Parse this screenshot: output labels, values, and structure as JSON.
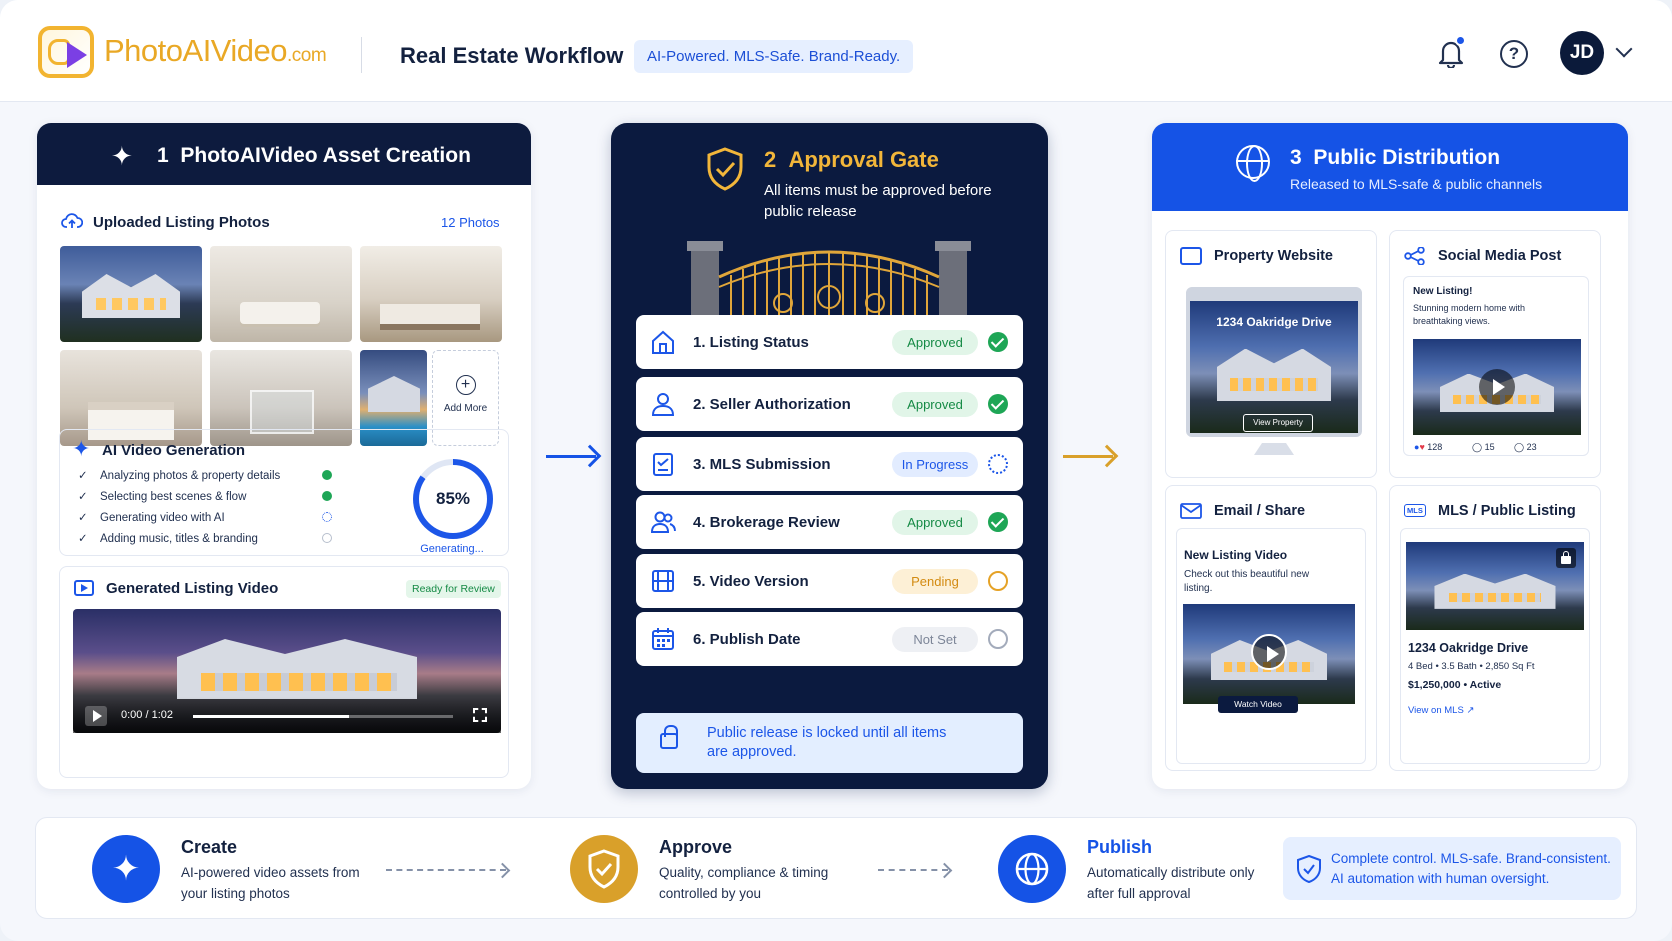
{
  "header": {
    "brand_main": "PhotoAIVideo",
    "brand_com": ".com",
    "title": "Real Estate Workflow",
    "tagline": "AI-Powered. MLS-Safe. Brand-Ready.",
    "avatar_initials": "JD",
    "help_glyph": "?"
  },
  "panel1": {
    "step": "1",
    "title": "PhotoAIVideo Asset Creation",
    "uploads_title": "Uploaded Listing Photos",
    "photo_count": "12 Photos",
    "photos": [
      "exterior-dusk",
      "living-room",
      "kitchen",
      "bedroom",
      "bathroom",
      "pool-exterior"
    ],
    "add_more": "Add More",
    "ai_title": "AI Video Generation",
    "ai_steps": [
      {
        "label": "Analyzing photos & property details",
        "status": "done"
      },
      {
        "label": "Selecting best scenes & flow",
        "status": "done"
      },
      {
        "label": "Generating video with AI",
        "status": "in-progress"
      },
      {
        "label": "Adding music, titles & branding",
        "status": "waiting"
      }
    ],
    "progress_percent": "85%",
    "progress_value": 0.85,
    "progress_label": "Generating...",
    "video_title": "Generated Listing Video",
    "video_badge": "Ready for Review",
    "video_time": "0:00 / 1:02",
    "video_played_fraction": 0.6
  },
  "panel2": {
    "step": "2",
    "title": "Approval Gate",
    "subtitle": "All items must be approved before public release",
    "items": [
      {
        "label": "1.  Listing Status",
        "status": "Approved",
        "icon": "house-icon"
      },
      {
        "label": "2.  Seller Authorization",
        "status": "Approved",
        "icon": "person-icon"
      },
      {
        "label": "3.  MLS Submission",
        "status": "In Progress",
        "icon": "clipboard-icon"
      },
      {
        "label": "4.  Brokerage Review",
        "status": "Approved",
        "icon": "people-icon"
      },
      {
        "label": "5.  Video Version",
        "status": "Pending",
        "icon": "film-icon"
      },
      {
        "label": "6.  Publish Date",
        "status": "Not Set",
        "icon": "calendar-icon"
      }
    ],
    "lock_message": "Public release is locked until all items are approved."
  },
  "panel3": {
    "step": "3",
    "title": "Public Distribution",
    "subtitle": "Released to MLS-safe & public channels",
    "website": {
      "title": "Property Website",
      "address": "1234 Oakridge Drive",
      "button": "View Property"
    },
    "social": {
      "title": "Social Media Post",
      "headline": "New Listing!",
      "text": "Stunning modern home with breathtaking views.",
      "likes": "128",
      "comments": "15",
      "shares": "23"
    },
    "email": {
      "title": "Email / Share",
      "headline": "New Listing Video",
      "text": "Check out this beautiful new listing.",
      "button": "Watch Video"
    },
    "mls": {
      "badge": "MLS",
      "title": "MLS / Public Listing",
      "address": "1234 Oakridge Drive",
      "specs": "4 Bed  •  3.5 Bath  •  2,850 Sq Ft",
      "price": "$1,250,000  •  Active",
      "link": "View on MLS"
    }
  },
  "footer": {
    "steps": [
      {
        "title": "Create",
        "text": "AI-powered video assets from your listing photos"
      },
      {
        "title": "Approve",
        "text": "Quality, compliance & timing controlled by you"
      },
      {
        "title": "Publish",
        "text": "Automatically distribute only after full approval"
      }
    ],
    "summary": "Complete control. MLS-safe. Brand-consistent. AI automation with human oversight."
  },
  "colors": {
    "brand_blue": "#1553e6",
    "navy": "#0b1a3f",
    "gold": "#f2b63a",
    "approved_green": "#1ea656",
    "pending_orange": "#e5a226"
  }
}
